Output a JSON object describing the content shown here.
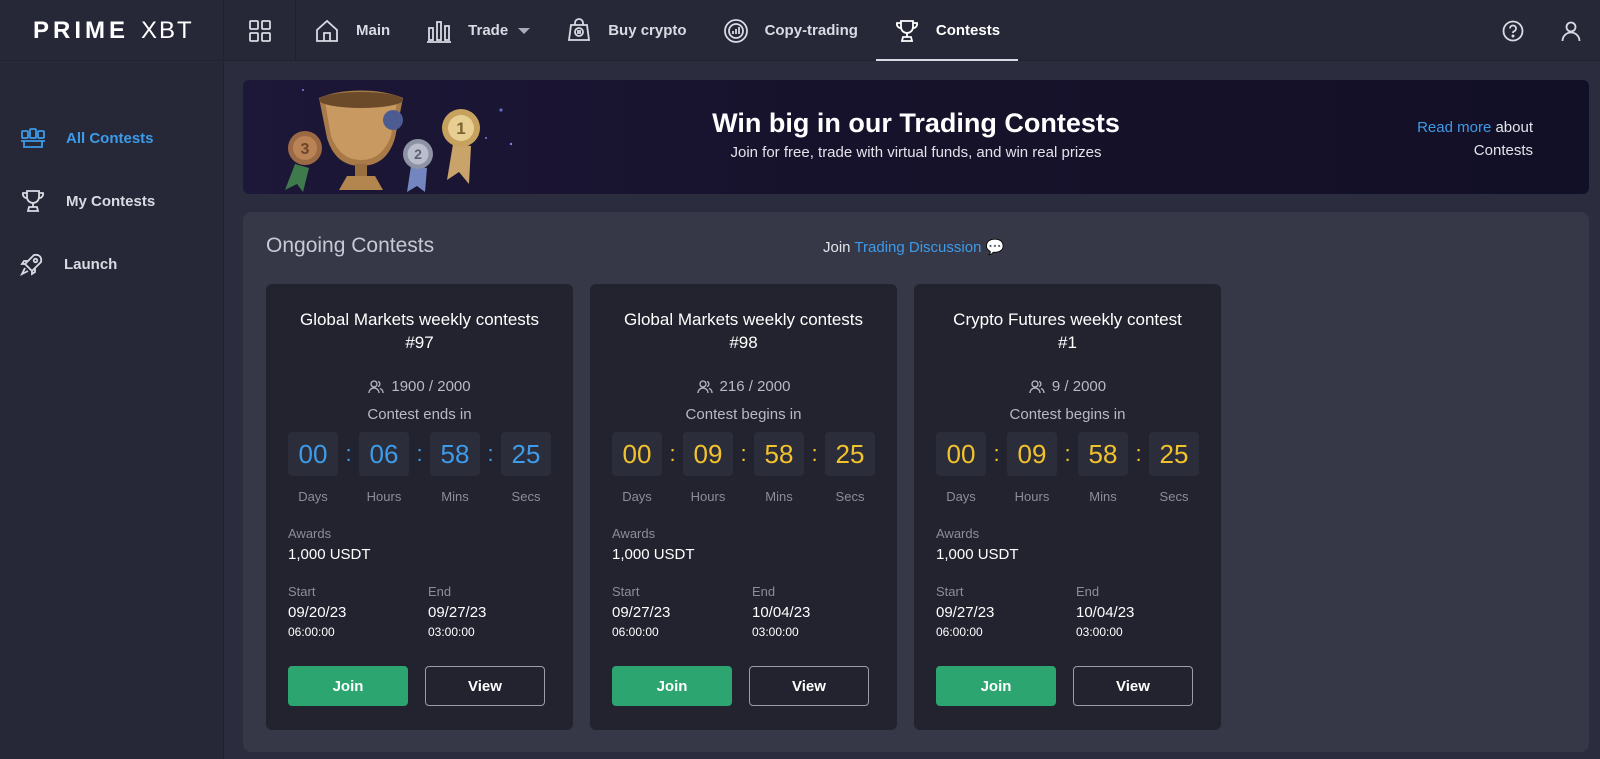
{
  "brand": {
    "part1": "PRIME",
    "part2": "XBT"
  },
  "nav": {
    "items": [
      {
        "label": "Main",
        "icon": "home-icon"
      },
      {
        "label": "Trade",
        "icon": "bar-chart-icon"
      },
      {
        "label": "Buy crypto",
        "icon": "buy-crypto-icon"
      },
      {
        "label": "Copy-trading",
        "icon": "copy-trading-icon"
      },
      {
        "label": "Contests",
        "icon": "trophy-icon",
        "active": true
      }
    ]
  },
  "sidebar": {
    "items": [
      {
        "label": "All Contests",
        "icon": "all-contests-icon",
        "active": true
      },
      {
        "label": "My Contests",
        "icon": "trophy-icon"
      },
      {
        "label": "Launch",
        "icon": "rocket-icon"
      }
    ]
  },
  "banner": {
    "title": "Win big in our Trading Contests",
    "subtitle": "Join for free, trade with virtual funds, and win real prizes",
    "read_more_link": "Read more",
    "read_more_rest": " about",
    "read_more_line2": "Contests"
  },
  "panel": {
    "title": "Ongoing Contests",
    "discussion_prefix": "Join ",
    "discussion_link": "Trading Discussion",
    "discussion_icon": "💬"
  },
  "timer_labels": {
    "days": "Days",
    "hours": "Hours",
    "mins": "Mins",
    "secs": "Secs"
  },
  "labels": {
    "awards": "Awards",
    "start": "Start",
    "end": "End",
    "join": "Join",
    "view": "View"
  },
  "colors": {
    "accent_blue": "#3d9be9",
    "timer_yellow": "#f2c22d",
    "join_green": "#2da570"
  },
  "cards": [
    {
      "title_line1": "Global Markets weekly contests",
      "title_line2": "#97",
      "participants": "1900 / 2000",
      "status": "Contest ends in",
      "timer": {
        "days": "00",
        "hours": "06",
        "mins": "58",
        "secs": "25"
      },
      "award": "1,000 USDT",
      "start_date": "09/20/23",
      "start_time": "06:00:00",
      "end_date": "09/27/23",
      "end_time": "03:00:00"
    },
    {
      "title_line1": "Global Markets weekly contests",
      "title_line2": "#98",
      "participants": "216 / 2000",
      "status": "Contest begins in",
      "timer": {
        "days": "00",
        "hours": "09",
        "mins": "58",
        "secs": "25"
      },
      "award": "1,000 USDT",
      "start_date": "09/27/23",
      "start_time": "06:00:00",
      "end_date": "10/04/23",
      "end_time": "03:00:00"
    },
    {
      "title_line1": "Crypto Futures weekly contest",
      "title_line2": "#1",
      "participants": "9 / 2000",
      "status": "Contest begins in",
      "timer": {
        "days": "00",
        "hours": "09",
        "mins": "58",
        "secs": "25"
      },
      "award": "1,000 USDT",
      "start_date": "09/27/23",
      "start_time": "06:00:00",
      "end_date": "10/04/23",
      "end_time": "03:00:00"
    }
  ]
}
